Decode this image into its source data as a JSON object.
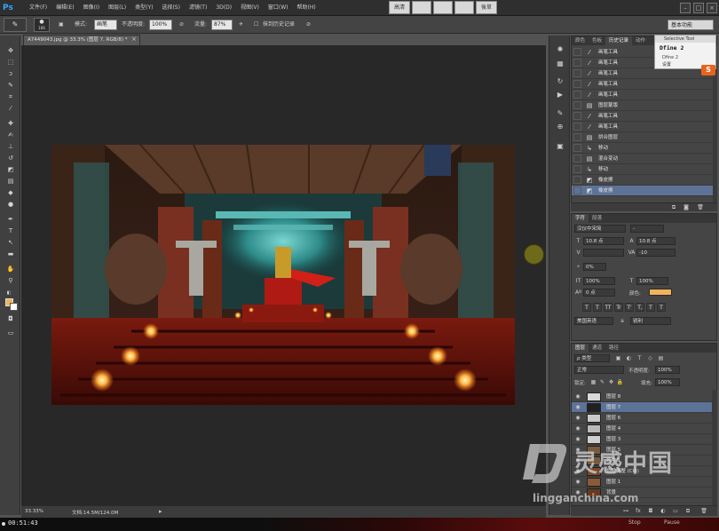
{
  "app": {
    "logo": "Ps"
  },
  "menu": {
    "items": [
      "文件(F)",
      "编辑(E)",
      "图像(I)",
      "图层(L)",
      "类型(Y)",
      "选择(S)",
      "滤镜(T)",
      "3D(D)",
      "视图(V)",
      "窗口(W)",
      "帮助(H)"
    ]
  },
  "mode_buttons": [
    "高清",
    "",
    "",
    "",
    "後草"
  ],
  "options": {
    "tool_preset": "✎",
    "brush_size": "166",
    "mode_label": "模式:",
    "mode_value": "画笔",
    "opacity_label": "不透明度:",
    "opacity_value": "100%",
    "flow_label": "流量:",
    "flow_value": "87%",
    "erase_history_label": "抹到历史记录",
    "workspace": "基本功能"
  },
  "document": {
    "tab_title": "A7449043.jpg @ 33.3% (图层 7, RGB/8) *",
    "zoom": "33.33%",
    "doc_size": "文档:14.5M/124.0M"
  },
  "taskbar": {
    "timer": "00:51:43",
    "btn1": "Stop",
    "btn2": "Pause"
  },
  "history": {
    "tabs": [
      "颜色",
      "色板",
      "历史记录",
      "动作"
    ],
    "active_tab": 2,
    "items": [
      {
        "icon": "brush",
        "label": "画笔工具"
      },
      {
        "icon": "brush",
        "label": "画笔工具"
      },
      {
        "icon": "brush",
        "label": "画笔工具"
      },
      {
        "icon": "brush",
        "label": "画笔工具"
      },
      {
        "icon": "brush",
        "label": "画笔工具"
      },
      {
        "icon": "doc",
        "label": "图层蒙版"
      },
      {
        "icon": "brush",
        "label": "画笔工具"
      },
      {
        "icon": "brush",
        "label": "画笔工具"
      },
      {
        "icon": "doc",
        "label": "拼合图层"
      },
      {
        "icon": "move",
        "label": "移动"
      },
      {
        "icon": "doc",
        "label": "混合变动"
      },
      {
        "icon": "move",
        "label": "移动"
      },
      {
        "icon": "eraser",
        "label": "橡皮擦"
      },
      {
        "icon": "eraser",
        "label": "橡皮擦"
      }
    ],
    "selected_index": 13
  },
  "selective_tool": {
    "title": "Selective Tool",
    "name": "Dfine 2",
    "sub": "Dfine 2",
    "setting": "设置"
  },
  "character": {
    "tabs": [
      "字符",
      "段落"
    ],
    "font_family": "汉仪中宋简",
    "font_style": "-",
    "font_size": "10.8 点",
    "leading": "10.8 点",
    "kerning": "",
    "tracking": "-10",
    "vscale_label": "0%",
    "hscale": "100%",
    "vscale": "100%",
    "baseline": "0 点",
    "color_label": "颜色:",
    "style_buttons": [
      "T",
      "T",
      "TT",
      "Tr",
      "T'",
      "T,",
      "T",
      "T"
    ],
    "lang": "美国英语",
    "aa_label": "a",
    "aa_value": "锐利",
    "color": "#f0b35a"
  },
  "layers": {
    "tabs": [
      "图层",
      "通道",
      "路径"
    ],
    "filter_label": "ρ 类型",
    "blend_mode": "正常",
    "opacity_label": "不透明度:",
    "opacity": "100%",
    "lock_label": "锁定:",
    "fill_label": "填充:",
    "fill": "100%",
    "items": [
      {
        "name": "图层 8",
        "thumb": "#d8d8d8",
        "eye": "◉"
      },
      {
        "name": "图层 7",
        "thumb": "#202020",
        "eye": "◉"
      },
      {
        "name": "图层 6",
        "thumb": "#c9c9c9",
        "eye": "◉"
      },
      {
        "name": "图层 4",
        "thumb": "#b9b9b9",
        "eye": "◉"
      },
      {
        "name": "图层 3",
        "thumb": "#cfcfcf",
        "eye": "◉"
      },
      {
        "name": "图层 5",
        "thumb": "#7a5a3e",
        "eye": "◉"
      },
      {
        "name": "色阶 1",
        "thumb": "#7a5a3e",
        "eye": "◉"
      },
      {
        "name": "色阶调整 (Cl4)",
        "thumb": "#7a4a2e",
        "eye": "◉"
      },
      {
        "name": "图层 1",
        "thumb": "#8a5a3a",
        "eye": "◉"
      },
      {
        "name": "背景",
        "thumb": "#6a3a1e",
        "eye": "◉"
      }
    ],
    "selected_index": 1
  },
  "watermark": {
    "text": "灵感中国",
    "url": "lingganchina.com"
  },
  "colors": {
    "foreground": "#f0b35a",
    "background": "#ffffff",
    "selection": "#5d7297"
  }
}
